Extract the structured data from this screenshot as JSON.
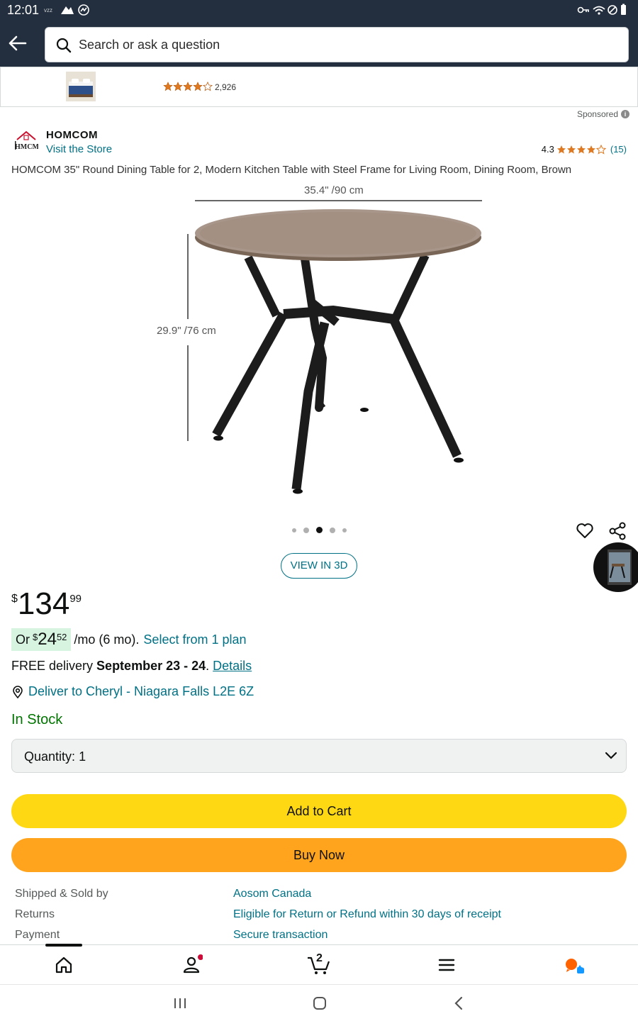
{
  "status_bar": {
    "time": "12:01",
    "carrier_small": "ᴠᴢᴢ"
  },
  "search": {
    "placeholder": "Search or ask a question"
  },
  "ad": {
    "rating_count": "2,926"
  },
  "sponsored_label": "Sponsored",
  "brand": {
    "name": "HOMCOM",
    "store_link": "Visit the Store",
    "rating": "4.3",
    "review_count": "(15)"
  },
  "product": {
    "title": "HOMCOM 35\" Round Dining Table for 2, Modern Kitchen Table with Steel Frame for Living Room, Dining Room, Brown",
    "dim_width": "35.4\" /90 cm",
    "dim_height": "29.9\" /76 cm",
    "carousel_count": 5,
    "carousel_active_index": 2
  },
  "view3d_label": "VIEW IN 3D",
  "price": {
    "symbol": "$",
    "whole": "134",
    "fraction": "99"
  },
  "installment": {
    "or": "Or",
    "symbol": "$",
    "whole": "24",
    "fraction": "52",
    "term": "/mo (6 mo).",
    "link": "Select from 1 plan"
  },
  "delivery": {
    "prefix": "FREE delivery",
    "date": "September 23 - 24",
    "period": ".",
    "details": "Details"
  },
  "deliver_to": "Deliver to Cheryl - Niagara Falls L2E 6Z",
  "stock": "In Stock",
  "quantity": {
    "label": "Quantity:",
    "value": "1"
  },
  "buttons": {
    "add_to_cart": "Add to Cart",
    "buy_now": "Buy Now"
  },
  "info_rows": [
    {
      "key": "Shipped & Sold by",
      "value": "Aosom Canada"
    },
    {
      "key": "Returns",
      "value": "Eligible for Return or Refund within 30 days of receipt"
    },
    {
      "key": "Payment",
      "value": "Secure transaction"
    }
  ],
  "bottom_nav": {
    "cart_count": "2"
  },
  "colors": {
    "header": "#232f3e",
    "link": "#007185",
    "in_stock": "#007600",
    "add_to_cart": "#ffd814",
    "buy_now": "#ffa41c",
    "star": "#de7921"
  }
}
